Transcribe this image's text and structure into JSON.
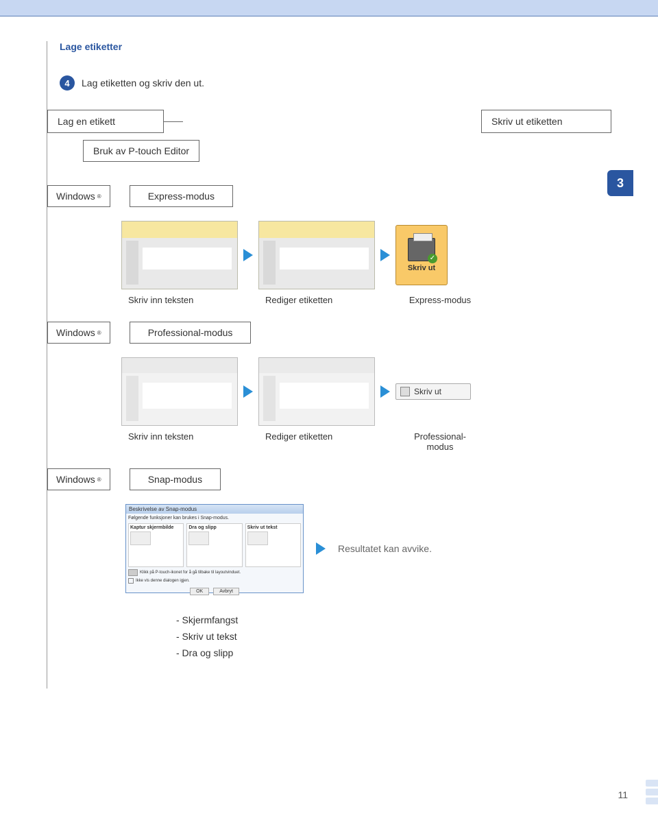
{
  "header": {
    "section_title": "Lage etiketter"
  },
  "step": {
    "number": "4",
    "text": "Lag etiketten og skriv den ut."
  },
  "boxes": {
    "create_label": "Lag en etikett",
    "print_label": "Skriv ut etiketten",
    "use_editor": "Bruk av P-touch Editor"
  },
  "chapter": "3",
  "os_label": "Windows",
  "os_suffix": "®",
  "modes": {
    "express": "Express-modus",
    "professional": "Professional-modus",
    "snap": "Snap-modus",
    "professional_wrapped": "Professional-modus"
  },
  "captions": {
    "enter_text": "Skriv inn teksten",
    "edit_label": "Rediger etiketten"
  },
  "print_button": {
    "big_label": "Skriv ut",
    "small_label": "Skriv ut"
  },
  "result_note": "Resultatet kan avvike.",
  "bullets": {
    "b1": "- Skjermfangst",
    "b2": "- Skriv ut tekst",
    "b3": "- Dra og slipp"
  },
  "dialog": {
    "title": "Beskrivelse av Snap-modus",
    "desc": "Følgende funksjoner kan brukes i Snap-modus.",
    "panel1_title": "Kaptur skjermbilde",
    "panel2_title": "Dra og slipp",
    "panel3_title": "Skriv ut tekst",
    "hint": "Klikk på P-touch-ikonet for å gå tilbake til layoutvinduet.",
    "show_again": "Ikke vis denne dialogen igjen.",
    "ok": "OK",
    "cancel": "Avbryt"
  },
  "page_number": "11"
}
